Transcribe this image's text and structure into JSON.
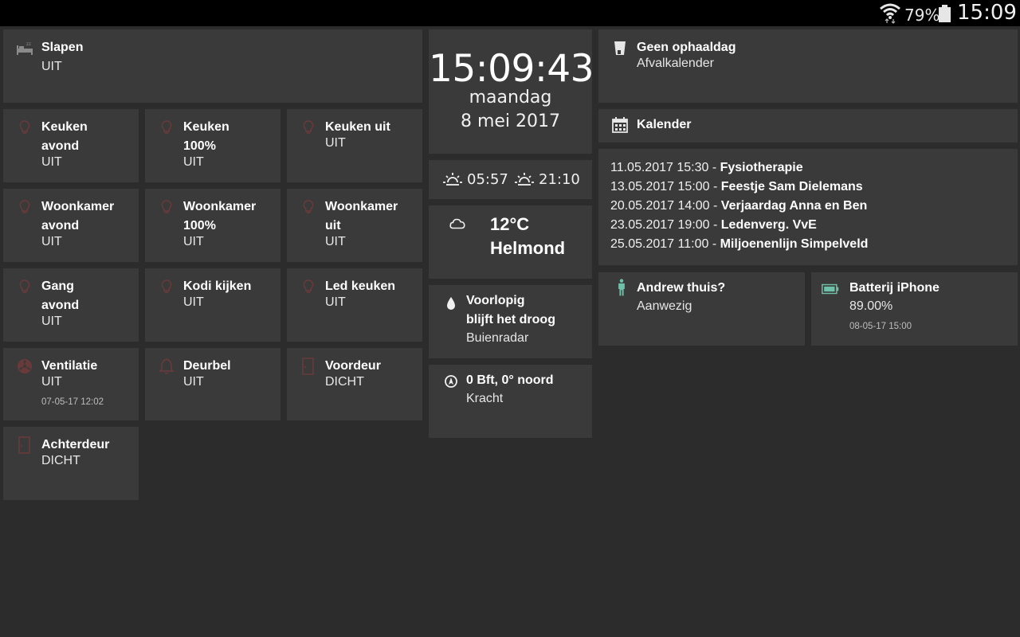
{
  "status_bar": {
    "battery_percent": "79%",
    "time": "15:09",
    "icons": [
      "wifi-icon",
      "battery-icon"
    ]
  },
  "tiles": {
    "slapen": {
      "title": "Slapen",
      "state": "UIT",
      "icon": "bed-icon"
    },
    "keuken_avond": {
      "title_line1": "Keuken",
      "title_line2": "avond",
      "state": "UIT",
      "icon": "bulb-icon"
    },
    "keuken_100": {
      "title_line1": "Keuken",
      "title_line2": "100%",
      "state": "UIT",
      "icon": "bulb-icon"
    },
    "keuken_uit": {
      "title": "Keuken uit",
      "state": "UIT",
      "icon": "bulb-icon"
    },
    "woonkamer_avond": {
      "title_line1": "Woonkamer",
      "title_line2": "avond",
      "state": "UIT",
      "icon": "bulb-icon"
    },
    "woonkamer_100": {
      "title_line1": "Woonkamer",
      "title_line2": "100%",
      "state": "UIT",
      "icon": "bulb-icon"
    },
    "woonkamer_uit": {
      "title_line1": "Woonkamer",
      "title_line2": "uit",
      "state": "UIT",
      "icon": "bulb-icon"
    },
    "gang_avond": {
      "title_line1": "Gang",
      "title_line2": "avond",
      "state": "UIT",
      "icon": "bulb-icon"
    },
    "kodi": {
      "title": "Kodi kijken",
      "state": "UIT",
      "icon": "bulb-icon"
    },
    "led_keuken": {
      "title": "Led keuken",
      "state": "UIT",
      "icon": "bulb-icon"
    },
    "ventilatie": {
      "title": "Ventilatie",
      "state": "UIT",
      "timestamp": "07-05-17 12:02",
      "icon": "fan-icon"
    },
    "deurbel": {
      "title": "Deurbel",
      "state": "UIT",
      "icon": "bell-icon"
    },
    "voordeur": {
      "title": "Voordeur",
      "state": "DICHT",
      "icon": "door-icon"
    },
    "achterdeur": {
      "title": "Achterdeur",
      "state": "DICHT",
      "icon": "door-icon"
    }
  },
  "clock": {
    "time": "15:09:43",
    "day": "maandag",
    "date": "8 mei 2017"
  },
  "sun": {
    "sunrise": "05:57",
    "sunset": "21:10",
    "icons": [
      "sunrise-icon",
      "sunset-icon"
    ]
  },
  "weather": {
    "temperature": "12°C",
    "city": "Helmond",
    "icon": "cloud-icon"
  },
  "rain": {
    "title_line1": "Voorlopig",
    "title_line2": "blijft het droog",
    "subtitle": "Buienradar",
    "icon": "raindrop-icon"
  },
  "wind": {
    "title": "0 Bft, 0° noord",
    "subtitle": "Kracht",
    "icon": "compass-icon"
  },
  "waste": {
    "title": "Geen ophaaldag",
    "subtitle": "Afvalkalender",
    "icon": "bin-icon"
  },
  "calendar": {
    "title": "Kalender",
    "icon": "calendar-icon",
    "events": [
      {
        "datetime": "11.05.2017 15:30",
        "name": "Fysiotherapie"
      },
      {
        "datetime": "13.05.2017 15:00",
        "name": "Feestje Sam Dielemans"
      },
      {
        "datetime": "20.05.2017 14:00",
        "name": "Verjaardag Anna en Ben"
      },
      {
        "datetime": "23.05.2017 19:00",
        "name": "Ledenverg. VvE"
      },
      {
        "datetime": "25.05.2017 11:00",
        "name": "Miljoenenlijn Simpelveld"
      }
    ]
  },
  "presence": {
    "title": "Andrew thuis?",
    "state": "Aanwezig",
    "icon": "person-icon"
  },
  "battery_iphone": {
    "title": "Batterij iPhone",
    "value": "89.00%",
    "timestamp": "08-05-17 15:00",
    "icon": "battery-full-icon"
  },
  "colors": {
    "background": "#2c2c2c",
    "tile": "#3a3a3a",
    "off_icon": "#6a3a3a",
    "presence_green": "#6fc0a8"
  }
}
